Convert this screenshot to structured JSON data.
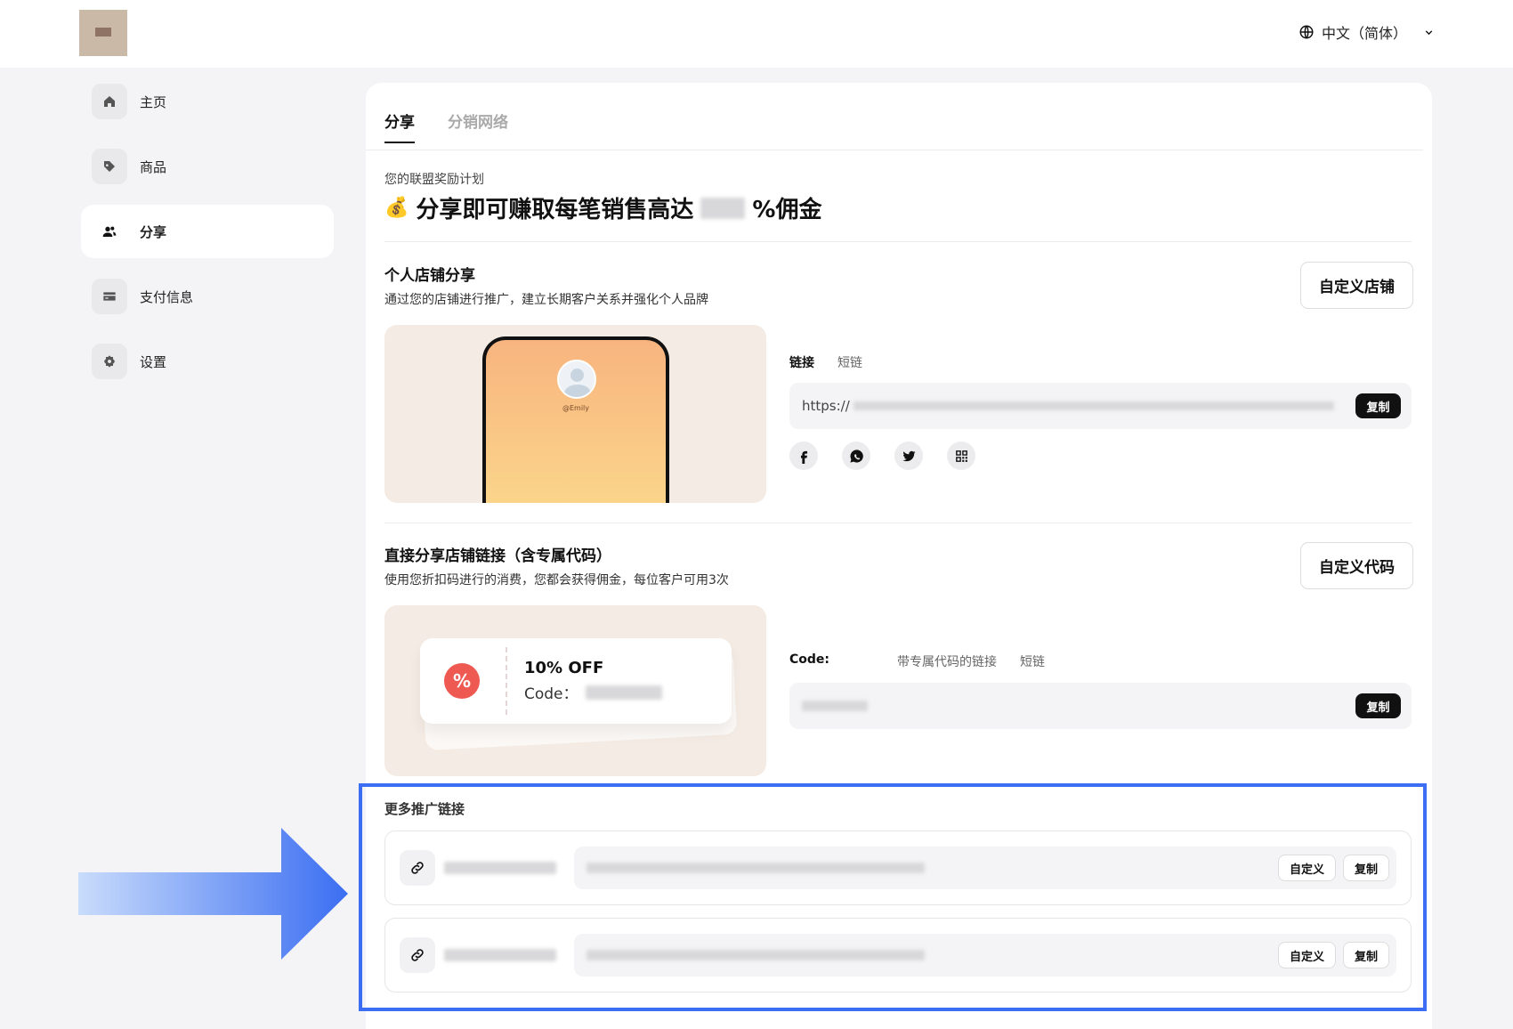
{
  "header": {
    "language": "中文（简体）"
  },
  "sidebar": {
    "items": [
      {
        "label": "主页",
        "icon": "home-icon"
      },
      {
        "label": "商品",
        "icon": "tag-icon"
      },
      {
        "label": "分享",
        "icon": "users-icon",
        "active": true
      },
      {
        "label": "支付信息",
        "icon": "card-icon"
      },
      {
        "label": "设置",
        "icon": "gear-icon"
      }
    ]
  },
  "tabs": [
    "分享",
    "分销网络"
  ],
  "program": {
    "subtitle": "您的联盟奖励计划",
    "emoji": "💰",
    "headline_prefix": "分享即可赚取每笔销售高达",
    "headline_suffix": "%佣金"
  },
  "store_share": {
    "title": "个人店铺分享",
    "subtitle": "通过您的店铺进行推广，建立长期客户关系并强化个人品牌",
    "button": "自定义店铺",
    "handle": "@Emily",
    "link_tabs": [
      "链接",
      "短链"
    ],
    "link_prefix": "https://",
    "copy": "复制",
    "socials": [
      "facebook-icon",
      "whatsapp-icon",
      "twitter-icon",
      "qr-code-icon"
    ]
  },
  "code_share": {
    "title": "直接分享店铺链接（含专属代码）",
    "subtitle": "使用您折扣码进行的消费，您都会获得佣金，每位客户可用3次",
    "button": "自定义代码",
    "coupon_off": "10% OFF",
    "coupon_code_label": "Code：",
    "code_label": "Code:",
    "link_tabs": [
      "带专属代码的链接",
      "短链"
    ],
    "copy": "复制"
  },
  "more_links": {
    "title": "更多推广链接",
    "rows": [
      {
        "customize": "自定义",
        "copy": "复制"
      },
      {
        "customize": "自定义",
        "copy": "复制"
      }
    ]
  },
  "colors": {
    "highlight": "#3b6ef2",
    "accent_dark": "#111111"
  }
}
